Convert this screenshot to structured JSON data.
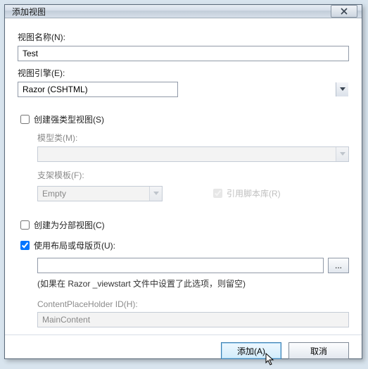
{
  "title": "添加视图",
  "labels": {
    "viewName": "视图名称(N):",
    "viewEngine": "视图引擎(E):",
    "createStrong": "创建强类型视图(S)",
    "modelClass": "模型类(M):",
    "scaffold": "支架模板(F):",
    "refScripts": "引用脚本库(R)",
    "partial": "创建为分部视图(C)",
    "useLayout": "使用布局或母版页(U):",
    "layoutHint": "(如果在 Razor _viewstart 文件中设置了此选项，则留空)",
    "cphId": "ContentPlaceHolder ID(H):"
  },
  "values": {
    "viewName": "Test",
    "viewEngine": "Razor (CSHTML)",
    "modelClass": "",
    "scaffold": "Empty",
    "layoutPath": "",
    "cphId": "MainContent"
  },
  "checks": {
    "createStrong": false,
    "refScripts": true,
    "partial": false,
    "useLayout": true
  },
  "buttons": {
    "browse": "...",
    "add": "添加(A)",
    "cancel": "取消"
  }
}
